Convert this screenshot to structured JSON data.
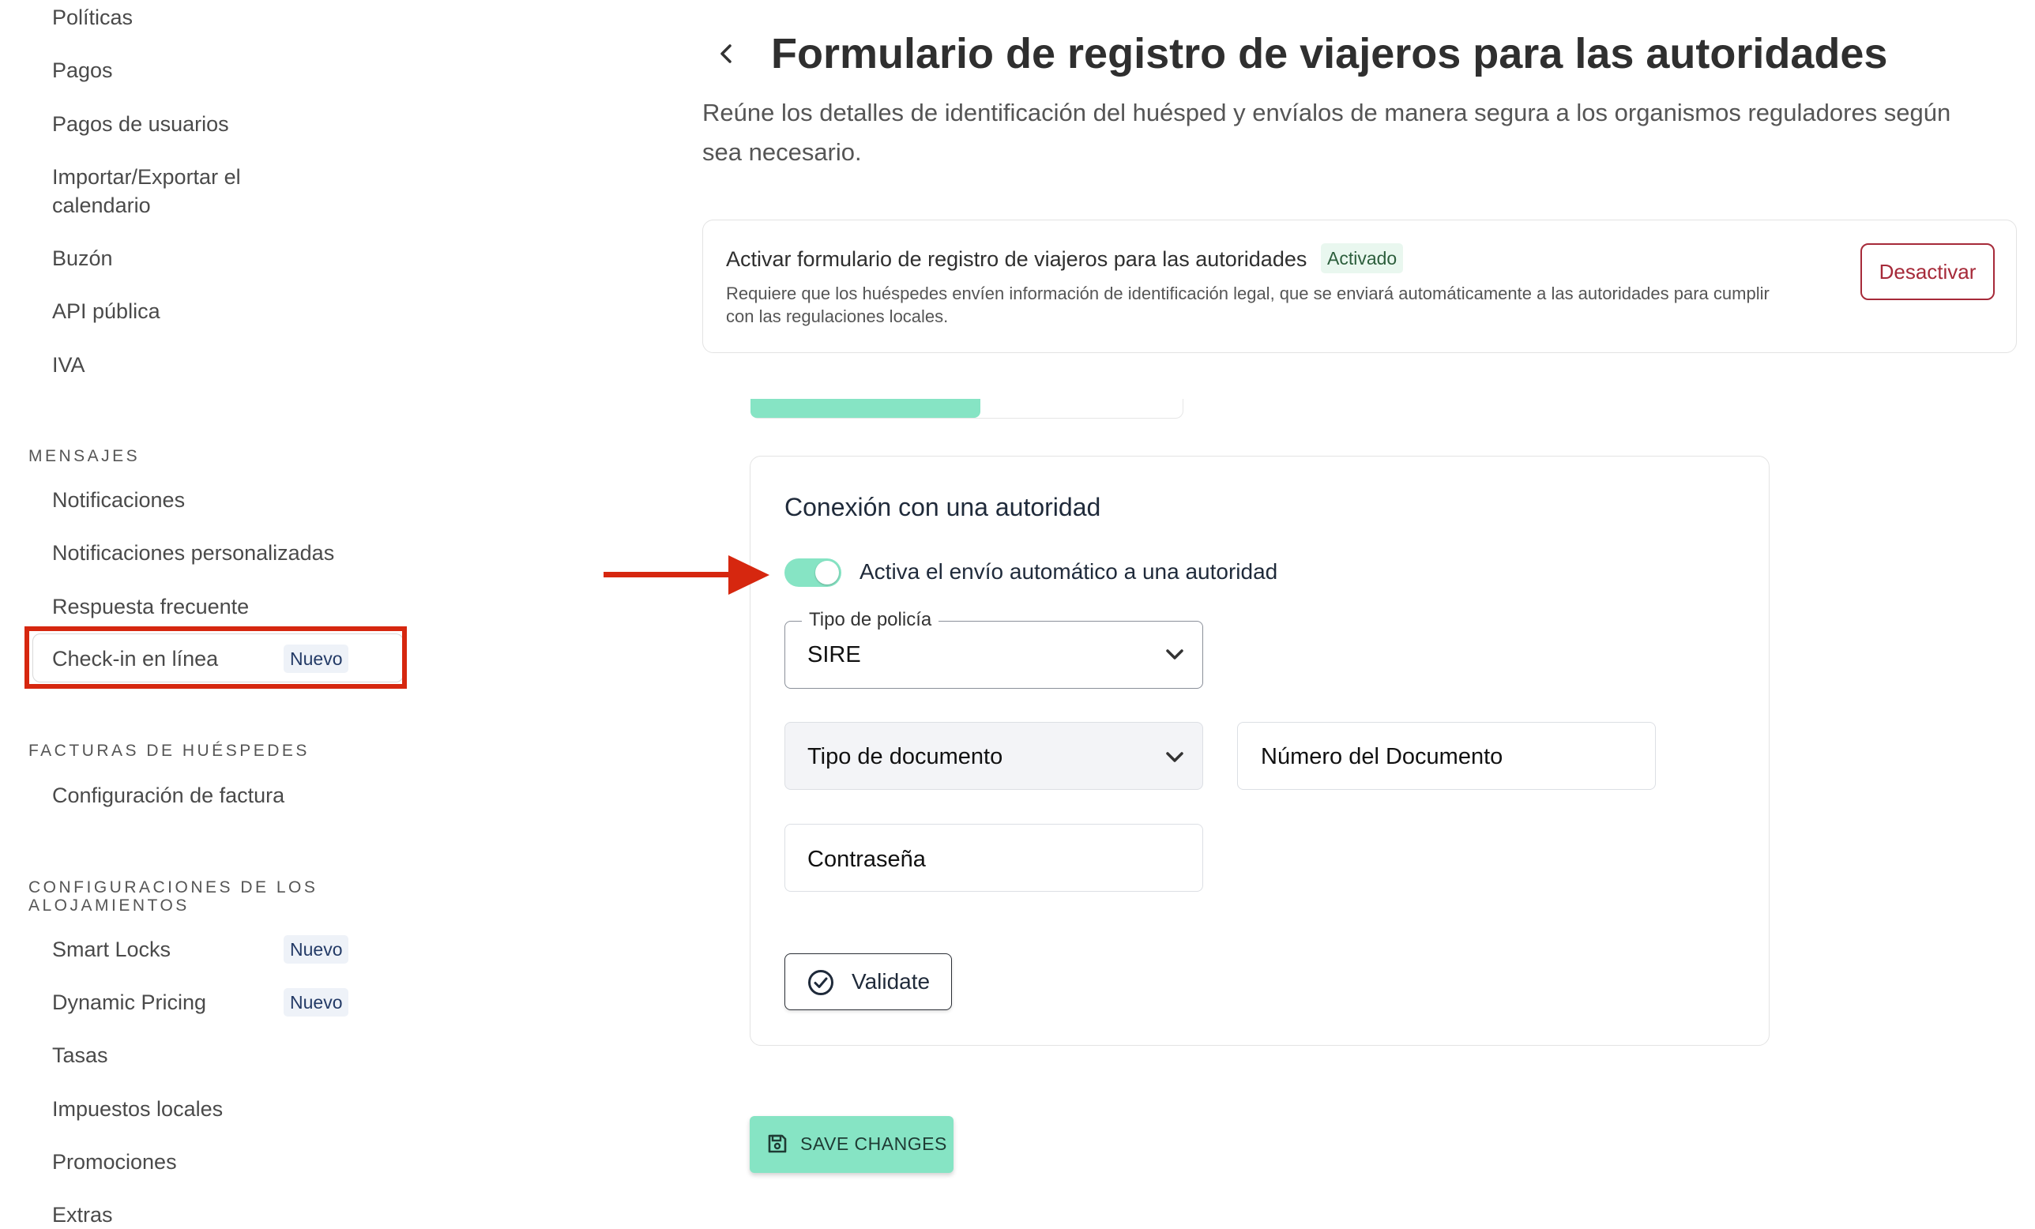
{
  "sidebar": {
    "items_top": [
      {
        "label": "Políticas"
      },
      {
        "label": "Pagos"
      },
      {
        "label": "Pagos de usuarios"
      },
      {
        "label": "Importar/Exportar el calendario"
      },
      {
        "label": "Buzón"
      },
      {
        "label": "API pública"
      },
      {
        "label": "IVA"
      }
    ],
    "sections": [
      {
        "heading": "MENSAJES",
        "items": [
          {
            "label": "Notificaciones"
          },
          {
            "label": "Notificaciones personalizadas"
          },
          {
            "label": "Respuesta frecuente"
          },
          {
            "label": "Check-in en línea",
            "badge": "Nuevo",
            "highlighted": true
          }
        ]
      },
      {
        "heading": "FACTURAS DE HUÉSPEDES",
        "items": [
          {
            "label": "Configuración de factura"
          }
        ]
      },
      {
        "heading": "CONFIGURACIONES DE LOS ALOJAMIENTOS",
        "items": [
          {
            "label": "Smart Locks",
            "badge": "Nuevo"
          },
          {
            "label": "Dynamic Pricing",
            "badge": "Nuevo"
          },
          {
            "label": "Tasas"
          },
          {
            "label": "Impuestos locales"
          },
          {
            "label": "Promociones"
          },
          {
            "label": "Extras"
          }
        ]
      }
    ]
  },
  "header": {
    "back_icon": "chevron-left-icon",
    "title": "Formulario de registro de viajeros para las autoridades",
    "subtitle": "Reúne los detalles de identificación del huésped y envíalos de manera segura a los organismos reguladores según sea necesario."
  },
  "activation": {
    "title": "Activar formulario de registro de viajeros para las autoridades",
    "status_badge": "Activado",
    "description": "Requiere que los huéspedes envíen información de identificación legal, que se enviará automáticamente a las autoridades para cumplir con las regulaciones locales.",
    "deactivate_label": "Desactivar"
  },
  "authority": {
    "title": "Conexión con una autoridad",
    "toggle_label": "Activa el envío automático a una autoridad",
    "toggle_on": true,
    "police_type": {
      "label": "Tipo de policía",
      "value": "SIRE"
    },
    "document_type": {
      "placeholder": "Tipo de documento"
    },
    "document_number": {
      "placeholder": "Número del Documento"
    },
    "password": {
      "placeholder": "Contraseña"
    },
    "validate_label": "Validate"
  },
  "save_label": "SAVE CHANGES",
  "colors": {
    "accent": "#86e4c4",
    "danger": "#a62a39",
    "annotation_red": "#d6270f"
  }
}
